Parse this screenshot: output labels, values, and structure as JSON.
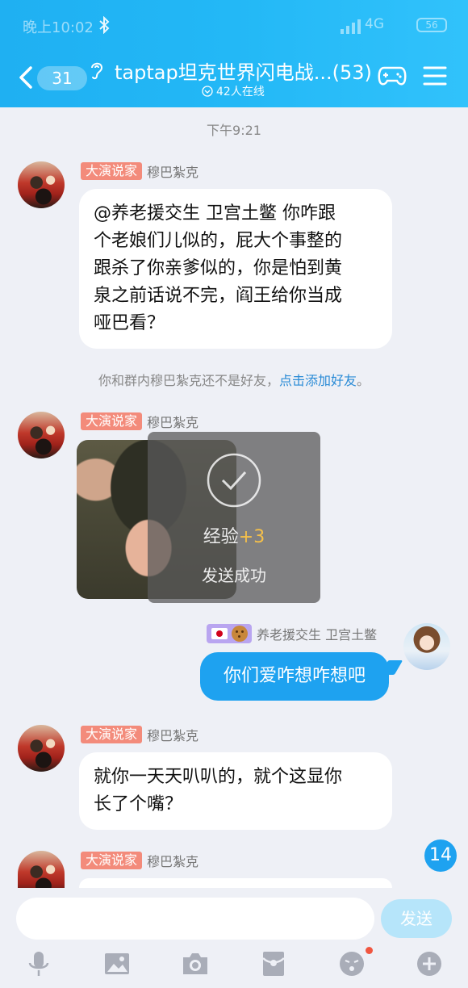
{
  "status_bar": {
    "time": "晚上10:02",
    "network": "4G",
    "battery": "56"
  },
  "header": {
    "back_count": "31",
    "title": "taptap坦克世界闪电战...(53)",
    "online": "42人在线"
  },
  "chat": {
    "timestamp": "下午9:21",
    "messages": [
      {
        "badge": "大演说家",
        "sender": "穆巴紮克",
        "lines": [
          "@养老援交生 卫宫土鳖 你咋跟",
          "个老娘们儿似的，屁大个事整的",
          "跟杀了你亲爹似的，你是怕到黄",
          "泉之前话说不完，阎王给你当成",
          "哑巴看？"
        ]
      },
      {
        "badge": "大演说家",
        "sender": "穆巴紮克"
      },
      {
        "sender": "养老援交生 卫宫土鳖",
        "text": "你们爱咋想咋想吧"
      },
      {
        "badge": "大演说家",
        "sender": "穆巴紮克",
        "lines": [
          "就你一天天叭叭的，就个这显你",
          "长了个嘴？"
        ]
      },
      {
        "badge": "大演说家",
        "sender": "穆巴紮克"
      }
    ],
    "system_note": {
      "text": "你和群内穆巴紮克还不是好友，",
      "link": "点击添加好友",
      "end": "。"
    },
    "toast": {
      "exp_label": "经验",
      "exp_value": "+3",
      "sent": "发送成功"
    },
    "unread": "14"
  },
  "input": {
    "placeholder": "",
    "send": "发送"
  },
  "colors": {
    "header": "#23b8f6",
    "accent": "#1ea2f0",
    "badge": "#f38b7b"
  }
}
